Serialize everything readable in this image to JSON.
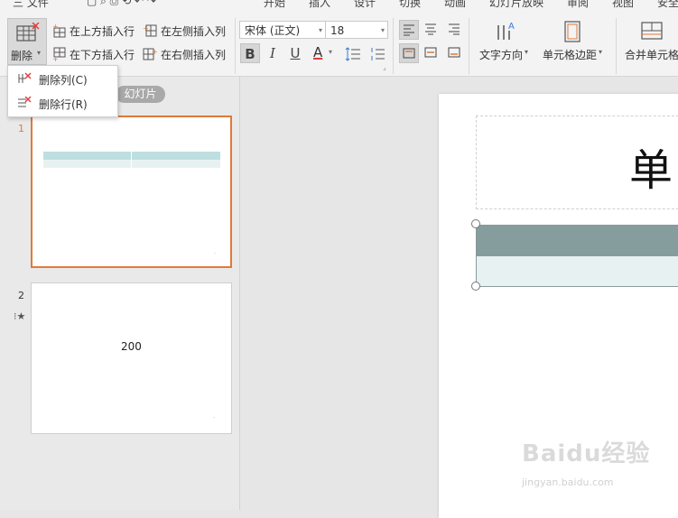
{
  "menu": {
    "items": [
      "三 文件",
      "开始",
      "插入",
      "设计",
      "切换",
      "动画",
      "幻灯片放映",
      "审阅",
      "视图",
      "安全"
    ]
  },
  "ribbon": {
    "delete_label": "删除",
    "insert_above": "在上方插入行",
    "insert_below": "在下方插入行",
    "insert_left": "在左侧插入列",
    "insert_right": "在右侧插入列",
    "font_name": "宋体 (正文)",
    "font_size": "18",
    "bold": "B",
    "italic": "I",
    "underline": "U",
    "font_color": "A",
    "text_direction": "文字方向",
    "cell_margin": "单元格边距",
    "merge_cells": "合并单元格"
  },
  "dropdown": {
    "items": [
      {
        "label": "删除列(C)"
      },
      {
        "label": "删除行(R)"
      }
    ]
  },
  "slides_panel": {
    "tab_label": "幻灯片",
    "slides": [
      {
        "number": "1",
        "content": ""
      },
      {
        "number": "2",
        "content": "200"
      }
    ]
  },
  "canvas": {
    "title_text": "单"
  },
  "watermark": {
    "text": "Baidu经验",
    "url": "jingyan.baidu.com"
  },
  "colors": {
    "accent": "#e07a3a",
    "table_header": "#859d9d",
    "table_row": "#e8f1f2",
    "thumb_header": "#bddfe0"
  }
}
